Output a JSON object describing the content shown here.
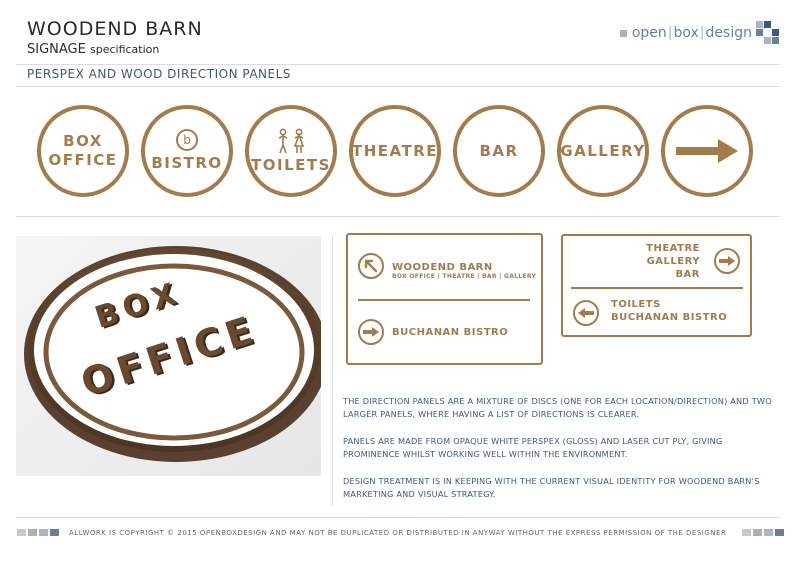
{
  "header": {
    "title": "WOODEND BARN",
    "subtitle_main": "SIGNAGE",
    "subtitle_spec": "specification",
    "section_title": "PERSPEX AND WOOD DIRECTION PANELS"
  },
  "logo": {
    "part1": "open",
    "part2": "box",
    "part3": "design",
    "colors": [
      "#b0b0b0",
      "#6a7f99",
      "#3e5a78",
      "#aab6c6"
    ]
  },
  "discs": [
    {
      "line1": "BOX",
      "line2": "OFFICE",
      "icon": ""
    },
    {
      "line1": "BISTRO",
      "line2": "",
      "icon": "bistro-b-icon",
      "glyph": "b"
    },
    {
      "line1": "TOILETS",
      "line2": "",
      "icon": "toilets-people-icon"
    },
    {
      "line1": "THEATRE",
      "line2": "",
      "icon": ""
    },
    {
      "line1": "BAR",
      "line2": "",
      "icon": ""
    },
    {
      "line1": "GALLERY",
      "line2": "",
      "icon": ""
    },
    {
      "line1": "",
      "line2": "",
      "icon": "arrow-right-icon"
    }
  ],
  "photo": {
    "line1": "BOX",
    "line2": "OFFICE"
  },
  "panel1": {
    "row1_title": "WOODEND BARN",
    "row1_sub": "BOX OFFICE | THEATRE | BAR | GALLERY",
    "row1_icon": "arrow-up-left-icon",
    "row2_title": "BUCHANAN BISTRO",
    "row2_icon": "arrow-right-icon"
  },
  "panel2": {
    "row1_lines": [
      "THEATRE",
      "GALLERY",
      "BAR"
    ],
    "row1_icon": "arrow-right-icon",
    "row2_lines": [
      "TOILETS",
      "BUCHANAN BISTRO"
    ],
    "row2_icon": "arrow-left-icon"
  },
  "description": [
    "THE DIRECTION PANELS ARE A MIXTURE OF DISCS (ONE FOR EACH LOCATION/DIRECTION) AND TWO LARGER PANELS, WHERE HAVING A LIST OF DIRECTIONS IS CLEARER.",
    "PANELS ARE MADE FROM OPAQUE WHITE PERSPEX (GLOSS) AND LASER CUT PLY, GIVING PROMINENCE WHILST WORKING WELL WITHIN THE ENVIRONMENT.",
    "DESIGN TREATMENT IS IN KEEPING WITH THE CURRENT VISUAL IDENTITY FOR WOODEND BARN'S MARKETING AND VISUAL STRATEGY."
  ],
  "footer": {
    "copyright": "ALLWORK IS COPYRIGHT © 2015 OPENBOXDESIGN AND MAY NOT BE DUPLICATED OR DISTRIBUTED IN ANYWAY WITHOUT THE EXPRESS PERMISSION OF THE DESIGNER"
  },
  "colors": {
    "wood": "#a37c4c",
    "blue_text": "#3a5a80",
    "rule": "#dcdcdc"
  }
}
